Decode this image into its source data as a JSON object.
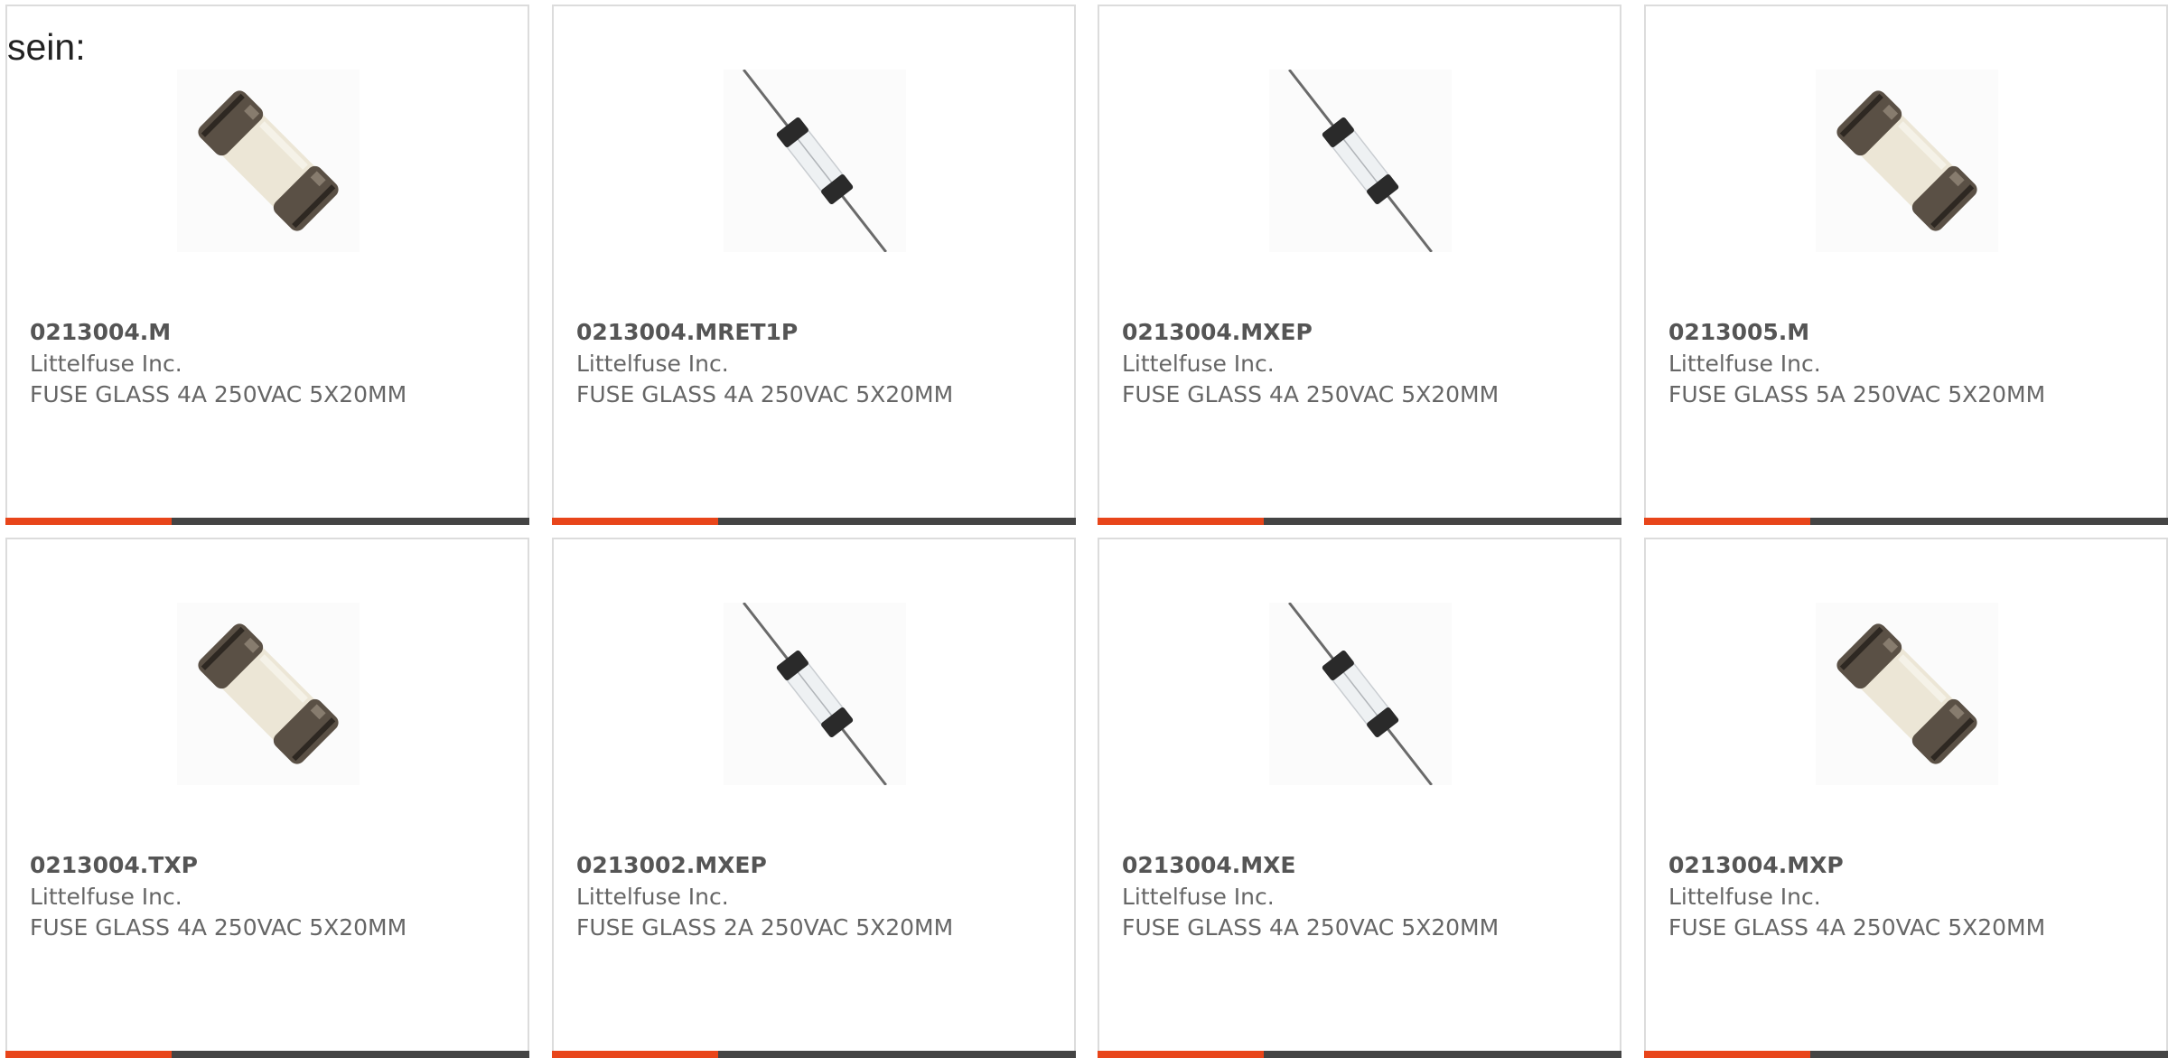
{
  "intro_text": "sein:",
  "colors": {
    "accent": "#e8451a",
    "bar_dark": "#444444",
    "border": "#dcdcdc"
  },
  "products": [
    {
      "part_number": "0213004.M",
      "manufacturer": "Littelfuse Inc.",
      "description": "FUSE GLASS 4A 250VAC 5X20MM",
      "image": "cartridge-fuse-icon"
    },
    {
      "part_number": "0213004.MRET1P",
      "manufacturer": "Littelfuse Inc.",
      "description": "FUSE GLASS 4A 250VAC 5X20MM",
      "image": "axial-lead-fuse-icon"
    },
    {
      "part_number": "0213004.MXEP",
      "manufacturer": "Littelfuse Inc.",
      "description": "FUSE GLASS 4A 250VAC 5X20MM",
      "image": "axial-lead-fuse-icon"
    },
    {
      "part_number": "0213005.M",
      "manufacturer": "Littelfuse Inc.",
      "description": "FUSE GLASS 5A 250VAC 5X20MM",
      "image": "cartridge-fuse-icon"
    },
    {
      "part_number": "0213004.TXP",
      "manufacturer": "Littelfuse Inc.",
      "description": "FUSE GLASS 4A 250VAC 5X20MM",
      "image": "cartridge-fuse-icon"
    },
    {
      "part_number": "0213002.MXEP",
      "manufacturer": "Littelfuse Inc.",
      "description": "FUSE GLASS 2A 250VAC 5X20MM",
      "image": "axial-lead-fuse-icon"
    },
    {
      "part_number": "0213004.MXE",
      "manufacturer": "Littelfuse Inc.",
      "description": "FUSE GLASS 4A 250VAC 5X20MM",
      "image": "axial-lead-fuse-icon"
    },
    {
      "part_number": "0213004.MXP",
      "manufacturer": "Littelfuse Inc.",
      "description": "FUSE GLASS 4A 250VAC 5X20MM",
      "image": "cartridge-fuse-icon"
    }
  ]
}
